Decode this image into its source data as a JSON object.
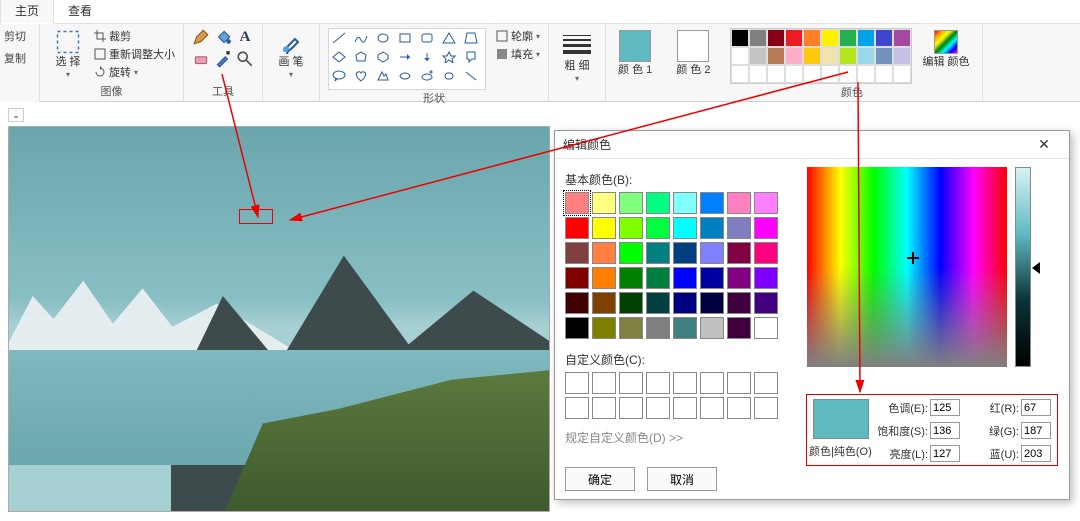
{
  "tabs": {
    "home": "主页",
    "view": "查看"
  },
  "clip": {
    "cut": "剪切",
    "copy": "复制"
  },
  "image_group": {
    "label": "图像",
    "select": "选\n择",
    "crop": "裁剪",
    "resize": "重新调整大小",
    "rotate": "旋转"
  },
  "tools_group": {
    "label": "工具"
  },
  "brush_group": {
    "brush": "画\n笔"
  },
  "shapes_group": {
    "label": "形状",
    "outline": "轮廓",
    "fill": "填充"
  },
  "size_group": {
    "label": "粗\n细"
  },
  "color1": {
    "label": "颜\n色 1"
  },
  "color2": {
    "label": "颜\n色 2"
  },
  "palette_label": "颜色",
  "edit_colors": "编辑\n颜色",
  "dialog": {
    "title": "编辑颜色",
    "basic_label": "基本颜色(B):",
    "custom_label": "自定义颜色(C):",
    "define": "规定自定义颜色(D) >>",
    "ok": "确定",
    "cancel": "取消",
    "preview_label": "颜色|纯色(O)",
    "hue_lbl": "色调(E):",
    "sat_lbl": "饱和度(S):",
    "lum_lbl": "亮度(L):",
    "r_lbl": "红(R):",
    "g_lbl": "绿(G):",
    "b_lbl": "蓝(U):",
    "hue": "125",
    "sat": "136",
    "lum": "127",
    "r": "67",
    "g": "187",
    "b": "203"
  },
  "palette_colors": {
    "row1": [
      "#000000",
      "#7f7f7f",
      "#880015",
      "#ed1c24",
      "#ff7f27",
      "#fff200",
      "#22b14c",
      "#00a2e8",
      "#3f48cc",
      "#a349a4"
    ],
    "row2": [
      "#ffffff",
      "#c3c3c3",
      "#b97a57",
      "#ffaec9",
      "#ffc90e",
      "#efe4b0",
      "#b5e61d",
      "#99d9ea",
      "#7092be",
      "#c8bfe7"
    ]
  },
  "basic_colors": [
    [
      "#ff8080",
      "#ffff80",
      "#80ff80",
      "#00ff80",
      "#80ffff",
      "#0080ff",
      "#ff80c0",
      "#ff80ff"
    ],
    [
      "#ff0000",
      "#ffff00",
      "#80ff00",
      "#00ff40",
      "#00ffff",
      "#0080c0",
      "#8080c0",
      "#ff00ff"
    ],
    [
      "#804040",
      "#ff8040",
      "#00ff00",
      "#008080",
      "#004080",
      "#8080ff",
      "#800040",
      "#ff0080"
    ],
    [
      "#800000",
      "#ff8000",
      "#008000",
      "#008040",
      "#0000ff",
      "#0000a0",
      "#800080",
      "#8000ff"
    ],
    [
      "#400000",
      "#804000",
      "#004000",
      "#004040",
      "#000080",
      "#000040",
      "#400040",
      "#400080"
    ],
    [
      "#000000",
      "#808000",
      "#808040",
      "#808080",
      "#408080",
      "#c0c0c0",
      "#400040",
      "#ffffff"
    ]
  ],
  "current_color": "#5fb9c1"
}
